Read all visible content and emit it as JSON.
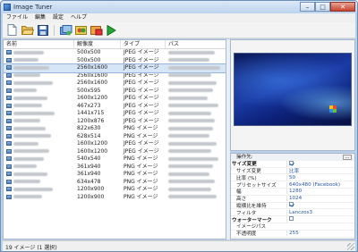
{
  "window": {
    "title": "Image Tuner",
    "minimize": "–",
    "maximize": "□",
    "close": "✕"
  },
  "menu": [
    "ファイル",
    "編集",
    "設定",
    "ヘルプ"
  ],
  "toolbar": {
    "icons": [
      "new-icon",
      "open-folder-icon",
      "save-icon",
      "add-images-icon",
      "settings-icon",
      "remove-icon",
      "run-icon"
    ]
  },
  "list": {
    "headers": {
      "name": "名前",
      "resolution": "解像度",
      "type": "タイプ",
      "path": "パス"
    },
    "rows": [
      {
        "res": "500x500",
        "type": "JPEG イメージ"
      },
      {
        "res": "500x500",
        "type": "JPEG イメージ"
      },
      {
        "res": "2560x1600",
        "type": "JPEG イメージ",
        "selected": true
      },
      {
        "res": "2560x1600",
        "type": "JPEG イメージ"
      },
      {
        "res": "2560x1600",
        "type": "JPEG イメージ"
      },
      {
        "res": "500x595",
        "type": "JPEG イメージ"
      },
      {
        "res": "1600x1200",
        "type": "JPEG イメージ"
      },
      {
        "res": "467x273",
        "type": "JPEG イメージ"
      },
      {
        "res": "1441x715",
        "type": "JPEG イメージ"
      },
      {
        "res": "1200x876",
        "type": "JPEG イメージ"
      },
      {
        "res": "822x630",
        "type": "PNG イメージ"
      },
      {
        "res": "628x514",
        "type": "PNG イメージ"
      },
      {
        "res": "1600x1200",
        "type": "JPEG イメージ"
      },
      {
        "res": "1600x1200",
        "type": "JPEG イメージ"
      },
      {
        "res": "540x540",
        "type": "PNG イメージ"
      },
      {
        "res": "361x940",
        "type": "PNG イメージ"
      },
      {
        "res": "361x940",
        "type": "PNG イメージ"
      },
      {
        "res": "634x478",
        "type": "PNG イメージ"
      },
      {
        "res": "1200x900",
        "type": "PNG イメージ"
      },
      {
        "res": "1200x900",
        "type": "PNG イメージ"
      }
    ]
  },
  "properties": [
    {
      "key": "操作先:",
      "value": "",
      "kind": "top"
    },
    {
      "key": "サイズ変更",
      "value": "",
      "kind": "cat",
      "check": true
    },
    {
      "key": "サイズ変更",
      "value": "比率"
    },
    {
      "key": "比率 (%)",
      "value": "50"
    },
    {
      "key": "プリセットサイズ",
      "value": "640x480 (Facebook)"
    },
    {
      "key": "幅",
      "value": "1280"
    },
    {
      "key": "高さ",
      "value": "1024"
    },
    {
      "key": "縦横比を維持",
      "value": "",
      "check": true
    },
    {
      "key": "フィルタ",
      "value": "Lanczos3"
    },
    {
      "key": "ウォーターマーク",
      "value": "",
      "kind": "cat",
      "check": false
    },
    {
      "key": "イメージパス",
      "value": ""
    },
    {
      "key": "不透明度",
      "value": "255"
    }
  ],
  "status": {
    "text": "19 イメージ (1 選択)"
  }
}
